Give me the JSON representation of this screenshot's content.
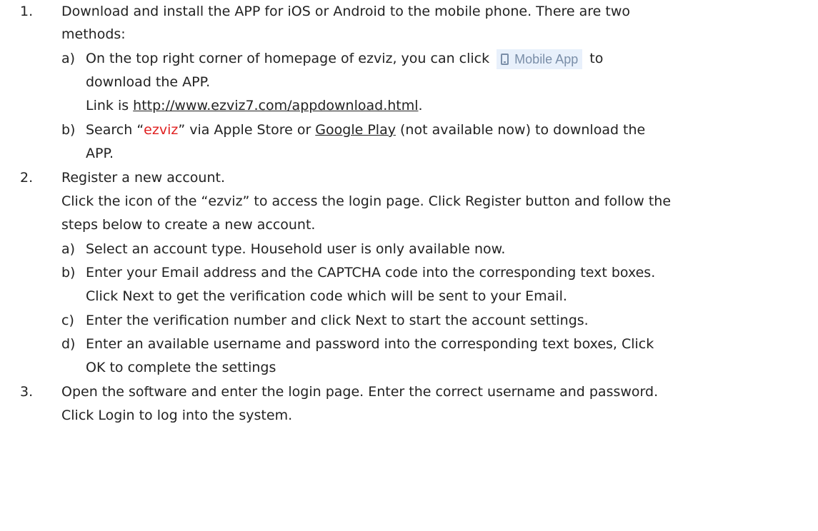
{
  "items": {
    "n1": "1.",
    "i1_line1": "Download and install the APP for iOS or Android to the mobile phone. There are two",
    "i1_line2": "methods:",
    "a_label": "a)",
    "a_line1_pre": "On the top right corner of homepage of ezviz, you can click",
    "mobile_app_button": "Mobile App",
    "a_line1_post": "to",
    "a_line2": "download the APP.",
    "a_line3_pre": "Link is ",
    "a_link": "http://www.ezviz7.com/appdownload.html",
    "a_line3_post": ".",
    "b_label": "b)",
    "b_pre": "Search “",
    "b_red": "ezviz",
    "b_mid": "” via Apple Store or ",
    "b_link": "Google Play",
    "b_post": " (not available now) to download the",
    "b_line2": "APP.",
    "n2": "2.",
    "i2_line1": "Register a new account.",
    "i2_line2": "Click the icon of the “ezviz” to access the login page. Click Register button and follow the",
    "i2_line3": "steps below to create a new account.",
    "s_a_label": "a)",
    "s_a": "Select an account type. Household user is only available now.",
    "s_b_label": "b)",
    "s_b1": "Enter your Email address and the CAPTCHA code into the corresponding text boxes.",
    "s_b2": "Click Next to get the verification code which will be sent to your Email.",
    "s_c_label": "c)",
    "s_c": "Enter the verification number and click Next to start the account settings.",
    "s_d_label": "d)",
    "s_d1": "Enter an available username and password into the corresponding text boxes, Click",
    "s_d2": "OK to complete the settings",
    "n3": "3.",
    "i3_line1": "Open the software and enter the login page. Enter the correct username and password.",
    "i3_line2": "Click Login to log into the system."
  }
}
